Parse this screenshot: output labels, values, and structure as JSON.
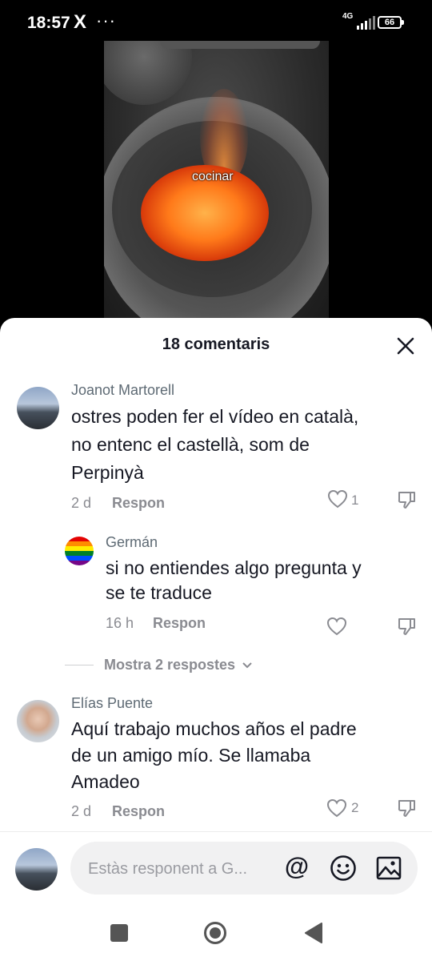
{
  "status": {
    "time": "18:57",
    "app_icon": "X",
    "more": "···",
    "network": "4G",
    "battery": "66"
  },
  "video": {
    "caption": "cocinar"
  },
  "comments_sheet": {
    "title": "18 comentaris",
    "comments": [
      {
        "author": "Joanot Martorell",
        "text": "ostres poden fer el vídeo en català,\nno entenc el castellà, som de\nPerpinyà",
        "age": "2 d",
        "reply_label": "Respon",
        "likes": "1"
      },
      {
        "author": "Germán",
        "text": "si no entiendes algo pregunta y\nse te traduce",
        "age": "16 h",
        "reply_label": "Respon",
        "likes": ""
      },
      {
        "author": "Elías Puente",
        "text": "Aquí trabajo muchos años el padre\nde un amigo mío. Se llamaba\nAmadeo",
        "age": "2 d",
        "reply_label": "Respon",
        "likes": "2"
      }
    ],
    "show_replies": "Mostra 2 respostes",
    "input_placeholder": "Estàs responent a G...",
    "mention_symbol": "@"
  }
}
